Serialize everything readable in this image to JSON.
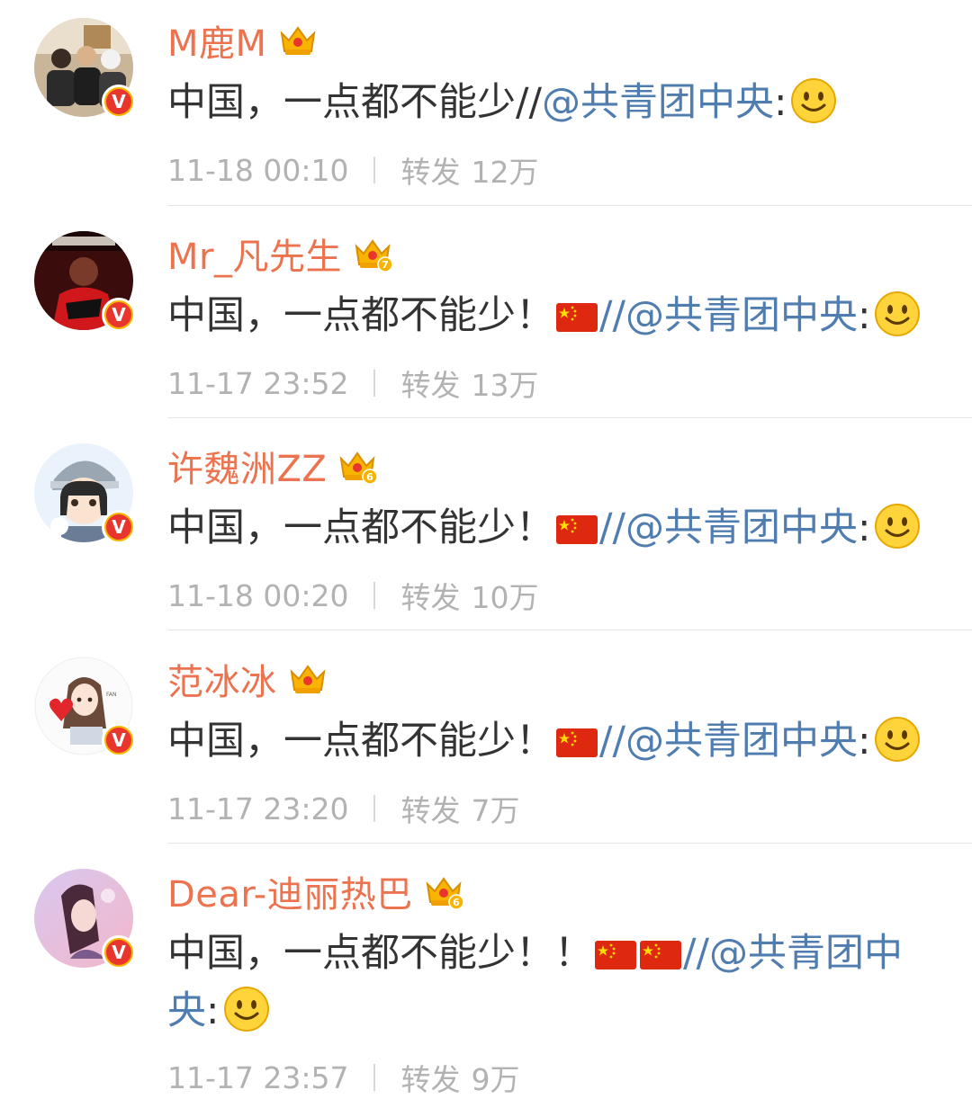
{
  "posts": [
    {
      "username": "M鹿M",
      "crown_level": "",
      "text_before": "中国，一点都不能少//",
      "flags": 0,
      "mention": "@共青团中央",
      "after_mention": ":",
      "time": "11-18 00:10",
      "repost_label": "转发",
      "repost_count": "12万"
    },
    {
      "username": "Mr_凡先生",
      "crown_level": "7",
      "text_before": "中国，一点都不能少！",
      "flags": 1,
      "mention": "//@共青团中央",
      "after_mention": ":",
      "time": "11-17 23:52",
      "repost_label": "转发",
      "repost_count": "13万"
    },
    {
      "username": "许魏洲ZZ",
      "crown_level": "6",
      "text_before": "中国，一点都不能少！",
      "flags": 1,
      "mention": "//@共青团中央",
      "after_mention": ":",
      "time": "11-18 00:20",
      "repost_label": "转发",
      "repost_count": "10万"
    },
    {
      "username": "范冰冰",
      "crown_level": "",
      "text_before": "中国，一点都不能少！",
      "flags": 1,
      "mention": "//@共青团中央",
      "after_mention": ":",
      "time": "11-17 23:20",
      "repost_label": "转发",
      "repost_count": "7万"
    },
    {
      "username": "Dear-迪丽热巴",
      "crown_level": "6",
      "text_before": "中国，一点都不能少！！",
      "flags": 2,
      "mention": "//@共青团中",
      "mention_cont": "央",
      "after_mention": ":",
      "time": "11-17 23:57",
      "repost_label": "转发",
      "repost_count": "9万"
    }
  ],
  "colors": {
    "username": "#eb7350",
    "mention": "#507daf",
    "body_text": "#333333",
    "meta_text": "#b2b2b2",
    "verified_badge": "#e8352e",
    "crown": "#f8b400"
  },
  "icons": {
    "crown": "vip-crown-icon",
    "verified": "verified-v-icon",
    "flag": "china-flag-emoji",
    "smile": "smile-emoji"
  },
  "avatar_mark_text": "V"
}
